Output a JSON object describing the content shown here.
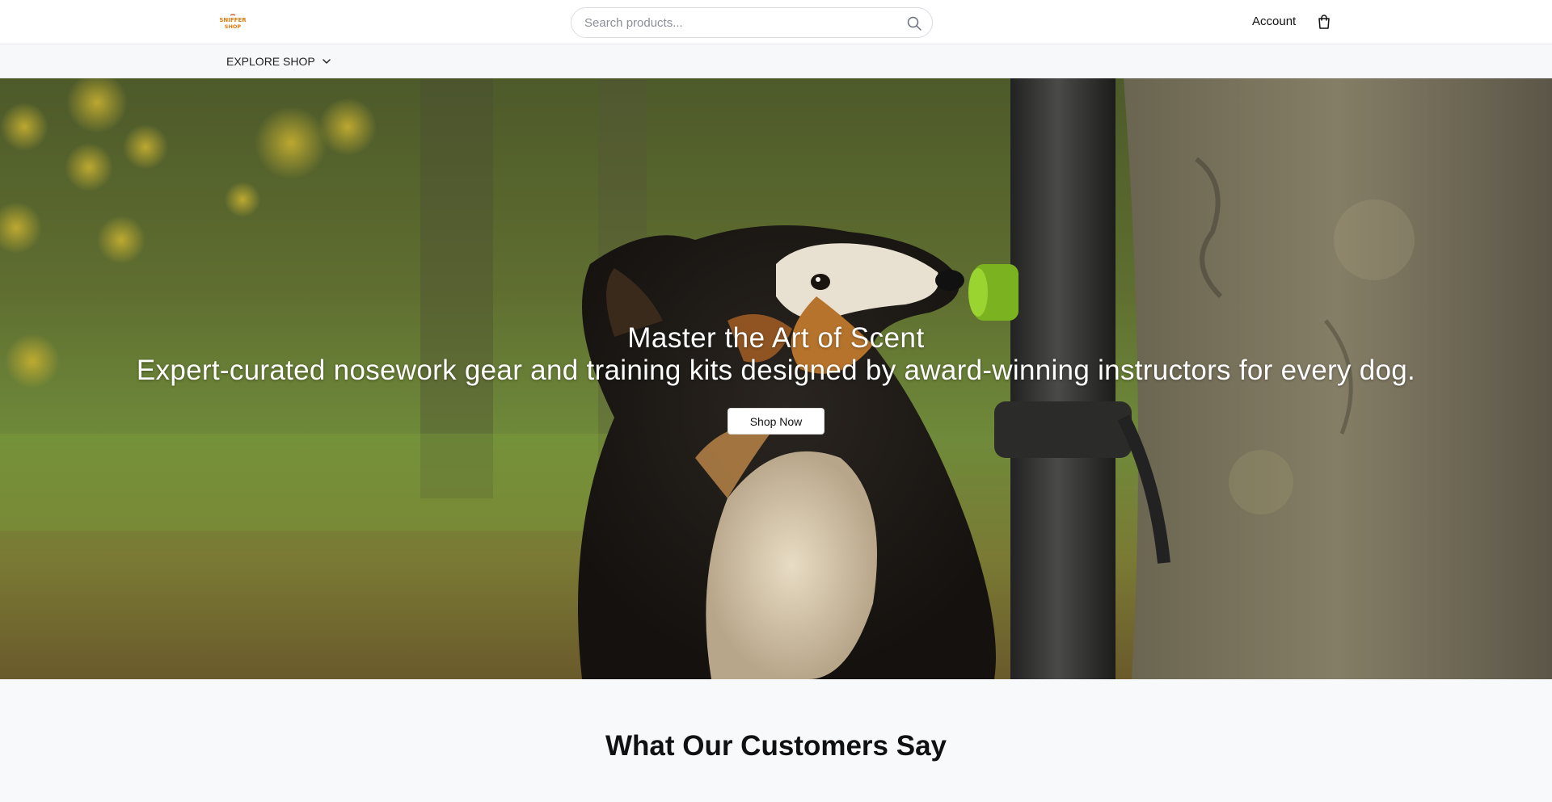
{
  "header": {
    "logo_text_1": "SNIFFER",
    "logo_text_2": "SHOP",
    "search_placeholder": "Search products...",
    "account_label": "Account"
  },
  "subnav": {
    "explore_label": "EXPLORE SHOP"
  },
  "hero": {
    "title": "Master the Art of Scent",
    "subtitle": "Expert-curated nosework gear and training kits designed by award-winning instructors for every dog.",
    "cta_label": "Shop Now"
  },
  "testimonials": {
    "title": "What Our Customers Say"
  },
  "colors": {
    "logo_orange": "#e07b12",
    "logo_red": "#c44a1a",
    "header_bg": "#ffffff",
    "page_bg": "#f8f9fb"
  },
  "icons": [
    "search-icon",
    "shopping-bag-icon",
    "chevron-down-icon"
  ]
}
